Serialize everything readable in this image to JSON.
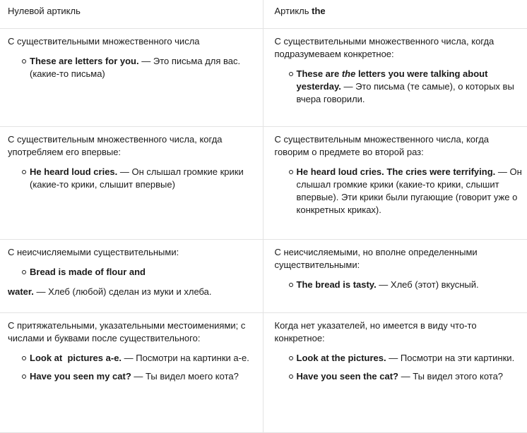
{
  "header": {
    "col1": "Нулевой артикль",
    "col2_prefix": "Артикль ",
    "col2_word": "the"
  },
  "rows": [
    {
      "left": {
        "rule": "С существительными множественного числа",
        "ex1_bold": "These are letters for you.",
        "ex1_text": " — Это письма для вас. (какие-то письма)"
      },
      "right": {
        "rule": "С существительными множественного числа, когда подразумеваем конкретное:",
        "ex1_bold_a": "These are ",
        "ex1_italic": "the",
        "ex1_bold_b": " letters you were talking about yesterday.",
        "ex1_text": " — Это письма (те самые), о которых вы вчера говорили."
      }
    },
    {
      "left": {
        "rule": "С существительным множественного числа, когда употребляем его впервые:",
        "ex1_bold": "He heard loud cries.",
        "ex1_text": " — Он слышал громкие крики (какие-то крики, слышит впервые)"
      },
      "right": {
        "rule": "С существительным множественного числа, когда говорим о предмете во второй раз:",
        "ex1_bold": "He heard loud cries. The cries were terrifying.",
        "ex1_text": " — Он слышал громкие крики (какие-то крики, слышит впервые). Эти крики были пугающие (говорит уже о конкретных криках)."
      }
    },
    {
      "left": {
        "rule": "С неисчисляемыми существительными:",
        "ex1_bold_a": "Bread is made of flour and",
        "ex1_bold_b": "water.",
        "ex1_text": " — Хлеб (любой) сделан из муки и хлеба."
      },
      "right": {
        "rule": "С неисчисляемыми, но вполне определенными существительными:",
        "ex1_bold": "The bread is tasty.",
        "ex1_text": " — Хлеб (этот) вкусный."
      }
    },
    {
      "left": {
        "rule": "С притяжательными, указательными местоимениями; с числами и буквами после существительного:",
        "ex1_bold": "Look at  pictures a-e.",
        "ex1_text": " — Посмотри на картинки а-е.",
        "ex2_bold": "Have you seen my cat?",
        "ex2_text": " — Ты видел моего кота?"
      },
      "right": {
        "rule": "Когда нет указателей, но имеется в виду что-то конкретное:",
        "ex1_bold": "Look at the pictures.",
        "ex1_text": " — Посмотри на эти картинки.",
        "ex2_bold": "Have you seen the cat?",
        "ex2_text": " — Ты видел этого кота?"
      }
    }
  ]
}
